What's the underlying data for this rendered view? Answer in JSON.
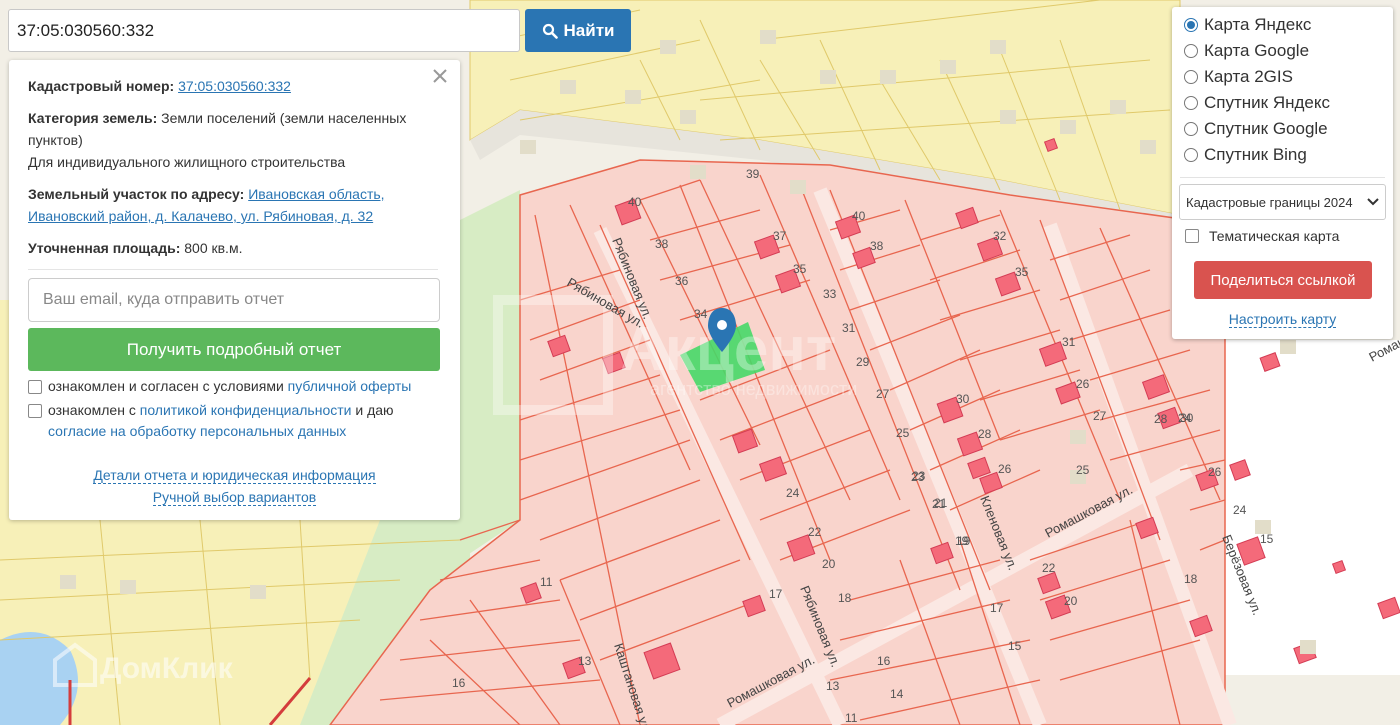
{
  "search": {
    "value": "37:05:030560:332",
    "button_label": "Найти"
  },
  "info": {
    "cadastral_label": "Кадастровый номер:",
    "cadastral_number": "37:05:030560:332",
    "category_label": "Категория земель:",
    "category_value": "Земли поселений (земли населенных пунктов)",
    "category_use": "Для индивидуального жилищного строительства",
    "address_label": "Земельный участок по адресу:",
    "address_value": "Ивановская область, Ивановский район, д. Калачево, ул. Рябиновая, д. 32",
    "area_label": "Уточненная площадь:",
    "area_value": "800 кв.м.",
    "email_placeholder": "Ваш email, куда отправить отчет",
    "report_button": "Получить подробный отчет",
    "consent1_pre": "ознакомлен и согласен с условиями",
    "consent1_link": "публичной оферты",
    "consent2_pre": "ознакомлен с",
    "consent2_link": "политикой конфиденциальности",
    "consent2_mid": "и даю",
    "consent2_link2": "согласие на обработку персональных данных",
    "link_details": "Детали отчета и юридическая информация",
    "link_manual": "Ручной выбор вариантов"
  },
  "layers": {
    "options": [
      {
        "label": "Карта Яндекс",
        "selected": true
      },
      {
        "label": "Карта Google",
        "selected": false
      },
      {
        "label": "Карта 2GIS",
        "selected": false
      },
      {
        "label": "Спутник Яндекс",
        "selected": false
      },
      {
        "label": "Спутник Google",
        "selected": false
      },
      {
        "label": "Спутник Bing",
        "selected": false
      }
    ],
    "boundaries_select": "Кадастровые границы 2024",
    "thematic_label": "Тематическая карта",
    "share_button": "Поделиться ссылкой",
    "setup_link": "Настроить карту"
  },
  "map": {
    "streets": {
      "ryabinovaya_top": "Рябиновая ул.",
      "ryabinovaya_bottom": "Рябиновая ул.",
      "ryabinovaya_left": "Рябиновая ул.",
      "romashkovaya_mid": "Ромашковая ул.",
      "romashkovaya_bottom": "Ромашковая ул.",
      "klenovaya": "Кленовая ул.",
      "berezovaya": "Берёзовая ул.",
      "kashtanovaya": "Каштановая ул.",
      "romashkovaya_edge": "Ромашк"
    },
    "plot_numbers": [
      "39",
      "38",
      "36",
      "34",
      "40",
      "37",
      "35",
      "33",
      "31",
      "29",
      "27",
      "25",
      "23",
      "21",
      "19",
      "17",
      "40",
      "38",
      "32",
      "35",
      "31",
      "30",
      "28",
      "26",
      "25",
      "27",
      "24",
      "22",
      "20",
      "18",
      "16",
      "14",
      "13",
      "11",
      "28",
      "26",
      "24",
      "22",
      "20",
      "18",
      "17",
      "15",
      "19",
      "21",
      "23",
      "26",
      "24",
      "30",
      "15",
      "16",
      "13",
      "11"
    ],
    "watermark_main": "Акцент",
    "watermark_sub": "агентство недвижимости",
    "watermark_bottom": "ДомКлик",
    "colors": {
      "residential_fill": "#f9d4cc",
      "residential_stroke": "#e8664f",
      "yellow_zone": "#f7f0b8",
      "building": "#f46a7a",
      "selected_plot": "#46d868",
      "marker": "#2a75b3"
    }
  }
}
